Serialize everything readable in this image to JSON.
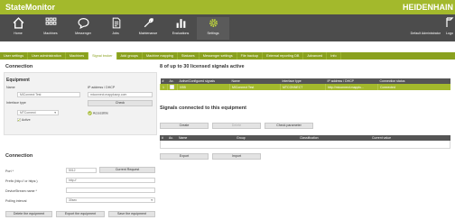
{
  "app": {
    "title": "StateMonitor",
    "brand": "HEIDENHAIN"
  },
  "toolbar": {
    "items": [
      {
        "label": "Home",
        "icon": "home-icon"
      },
      {
        "label": "Machines",
        "icon": "machines-grid-icon"
      },
      {
        "label": "Messenger",
        "icon": "chat-icon"
      },
      {
        "label": "Jobs",
        "icon": "document-icon"
      },
      {
        "label": "Maintenance",
        "icon": "wrench-icon"
      },
      {
        "label": "Evaluations",
        "icon": "bar-chart-icon"
      },
      {
        "label": "Settings",
        "icon": "gear-icon"
      }
    ],
    "active": "Settings",
    "user": "Default Administrator",
    "logout": "Logo"
  },
  "tabs": [
    "User settings",
    "User administration",
    "Machines",
    "Signal broker",
    "Add groups",
    "Machine mapping",
    "Statuses",
    "Messenger settings",
    "File backup",
    "External reporting DB",
    "Advanced",
    "Info"
  ],
  "active_tab": "Signal broker",
  "connection_panel": {
    "title": "Connection",
    "equipment": {
      "heading": "Equipment",
      "name_label": "Name",
      "name_value": "MIConnect Test",
      "ip_label": "IP address / DHCP",
      "ip_value": "miconnect.mapplusnp.com",
      "interface_label": "Interface type",
      "check_button": "Check",
      "interface_value": "MTConnect",
      "accessibility": "Accessible",
      "active_label": "Active"
    },
    "connection": {
      "heading": "Connection",
      "port_label": "Port *",
      "port_value": "5012",
      "current_request_button": "Current Request",
      "prefix_label": "Prefix (http:// or https:)",
      "prefix_value": "http://",
      "device_label": "DeviceStream name *",
      "device_value": "",
      "polling_label": "Polling interval",
      "polling_value": "30sec"
    },
    "buttons": {
      "delete": "Delete the equipment",
      "export": "Export the equipment",
      "save": "Save the equipment"
    }
  },
  "signals_summary": {
    "title": "8 of up to 30 licensed signals active",
    "columns": [
      "#",
      "Ac.",
      "Active/Configured signals",
      "Name",
      "Interface type",
      "IP address / DHCP",
      "Connection status"
    ],
    "rows": [
      [
        "1",
        "",
        "0/55",
        "MIConnect Test",
        "MTCONNECT",
        "http://miconnect.mapplu...",
        "Connected"
      ]
    ]
  },
  "signals_connected": {
    "title": "Signals connected to this equipment",
    "create_button": "Create",
    "delete_button": "Delete",
    "check_param_button": "Check parameter",
    "columns": [
      "#",
      "Ac.",
      "Name",
      "Group",
      "Classification",
      "Current value"
    ],
    "export_button": "Export",
    "import_button": "Import"
  },
  "colors": {
    "brand_green": "#a3b92c",
    "toolbar_dark": "#4c4c4c",
    "tab_green": "#8aa11f"
  }
}
